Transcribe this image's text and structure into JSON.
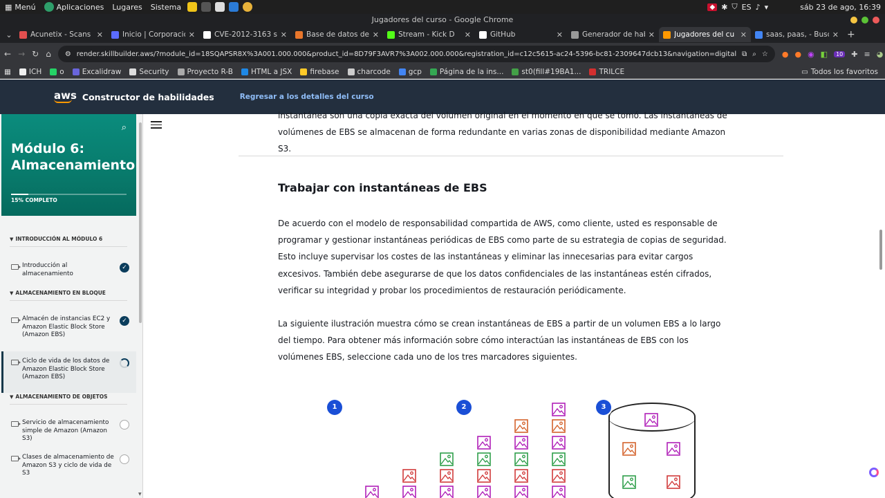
{
  "os": {
    "menu": "Menú",
    "apps": "Aplicaciones",
    "places": "Lugares",
    "system": "Sistema",
    "lang": "ES",
    "datetime": "sáb 23 de ago, 16:39"
  },
  "window_title": "Jugadores del curso - Google Chrome",
  "tabs": [
    {
      "title": "Acunetix - Scans",
      "color": "#e34f4f",
      "active": false
    },
    {
      "title": "Inicio | Corporacion",
      "color": "#5b6cff",
      "active": false
    },
    {
      "title": "CVE-2012-3163 s",
      "color": "#ffffff",
      "active": false
    },
    {
      "title": "Base de datos de",
      "color": "#e8762b",
      "active": false
    },
    {
      "title": "Stream - Kick D",
      "color": "#53fc18",
      "active": false
    },
    {
      "title": "GitHub",
      "color": "#ffffff",
      "active": false
    },
    {
      "title": "Generador de hab",
      "color": "#999999",
      "active": false
    },
    {
      "title": "Jugadores del cu",
      "color": "#ff9900",
      "active": true
    },
    {
      "title": "saas, paas, - Busc",
      "color": "#4285f4",
      "active": false
    }
  ],
  "url": "render.skillbuilder.aws/?module_id=18SQAPSR8X%3A001.000.000&product_id=8D79F3AVR7%3A002.000.000&registration_id=c12c5615-ac24-5396-bc81-2309647dcb13&navigation=digital",
  "ext_badge": "10",
  "bookmarks": [
    {
      "label": "ICH",
      "color": "#f0f0f0"
    },
    {
      "label": "o",
      "color": "#25d366"
    },
    {
      "label": "Excalidraw",
      "color": "#6965db"
    },
    {
      "label": "Security",
      "color": "#dddddd"
    },
    {
      "label": "Proyecto R-B",
      "color": "#aaaaaa"
    },
    {
      "label": "HTML a JSX",
      "color": "#1e88e5"
    },
    {
      "label": "firebase",
      "color": "#ffca28"
    },
    {
      "label": "charcode",
      "color": "#cccccc"
    },
    {
      "label": "gcp",
      "color": "#4285f4"
    },
    {
      "label": "Página de la ins...",
      "color": "#34a853"
    },
    {
      "label": "st0(fill#19BA1...",
      "color": "#43a047"
    },
    {
      "label": "TRILCE",
      "color": "#d32f2f"
    }
  ],
  "bookmarks_all": "Todos los favoritos",
  "app": {
    "logo": "aws",
    "name": "Constructor de habilidades",
    "back_link": "Regresar a los detalles del curso"
  },
  "sidebar": {
    "module_title": "Módulo 6: Almacenamiento",
    "progress_label": "15% COMPLETO",
    "progress": 0.15,
    "sections": [
      {
        "label": "INTRODUCCIÓN AL MÓDULO 6"
      },
      {
        "label": "ALMACENAMIENTO EN BLOQUE"
      },
      {
        "label": "ALMACENAMIENTO DE OBJETOS"
      }
    ],
    "items": [
      {
        "label": "Introducción al almacenamiento",
        "status": "done"
      },
      {
        "label": "Almacén de instancias EC2 y Amazon Elastic Block Store (Amazon EBS)",
        "status": "done"
      },
      {
        "label": "Ciclo de vida de los datos de Amazon Elastic Block Store (Amazon EBS)",
        "status": "partial"
      },
      {
        "label": "Servicio de almacenamiento simple de Amazon (Amazon S3)",
        "status": "empty"
      },
      {
        "label": "Clases de almacenamiento de Amazon S3 y ciclo de vida de S3",
        "status": "empty"
      }
    ]
  },
  "content": {
    "top_fragment_1": "instantánea son una copia exacta del volumen original en el momento en que se tomó. Las instantáneas de",
    "top_fragment_2": "volúmenes de EBS se almacenan de forma redundante en varias zonas de disponibilidad mediante Amazon S3.",
    "heading": "Trabajar con instantáneas de EBS",
    "para1": "De acuerdo con el modelo de responsabilidad compartida de AWS, como cliente, usted es responsable de programar y gestionar instantáneas periódicas de EBS como parte de su estrategia de copias de seguridad. Esto incluye supervisar los costes de las instantáneas y eliminar las innecesarias para evitar cargos excesivos. También debe asegurarse de que los datos confidenciales de las instantáneas estén cifrados, verificar su integridad y probar los procedimientos de restauración periódicamente.",
    "para2": "La siguiente ilustración muestra cómo se crean instantáneas de EBS a partir de un volumen EBS a lo largo del tiempo. Para obtener más información sobre cómo interactúan las instantáneas de EBS con los volúmenes EBS, seleccione cada uno de los tres marcadores siguientes.",
    "markers": [
      "1",
      "2",
      "3"
    ]
  },
  "colors": {
    "header_bg": "#232f3e",
    "module_green": "#087a6b",
    "marker_blue": "#1a4fd6",
    "icon_purple": "#b01fb8",
    "icon_orange": "#d4622b",
    "icon_green": "#2e9e4a",
    "icon_red": "#d13a3a"
  }
}
